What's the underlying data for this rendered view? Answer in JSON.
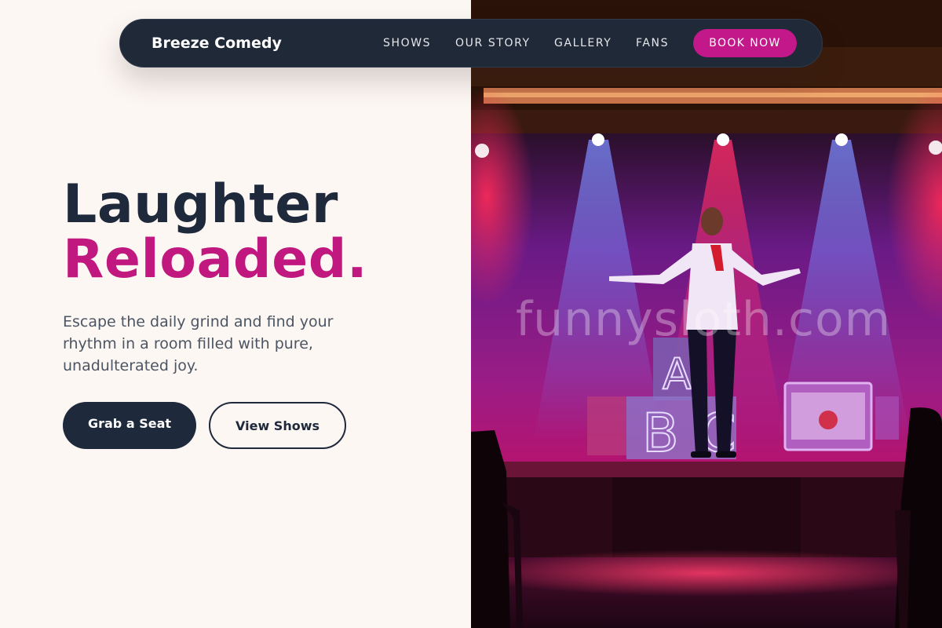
{
  "nav": {
    "brand": "Breeze Comedy",
    "links": [
      "SHOWS",
      "OUR STORY",
      "GALLERY",
      "FANS"
    ],
    "cta": "BOOK NOW"
  },
  "hero": {
    "title_line1": "Laughter",
    "title_line2": "Reloaded.",
    "subtitle": "Escape the daily grind and find your rhythm in a room filled with pure, unadulterated joy.",
    "primary_button": "Grab a Seat",
    "secondary_button": "View Shows"
  },
  "image": {
    "description_icon": "comedy-stage-photo",
    "watermark": "funnysloth.com",
    "backdrop_letters": [
      "A",
      "B",
      "C"
    ]
  },
  "colors": {
    "navy": "#1e293b",
    "accent": "#c0187f",
    "background": "#fdf7f3"
  }
}
